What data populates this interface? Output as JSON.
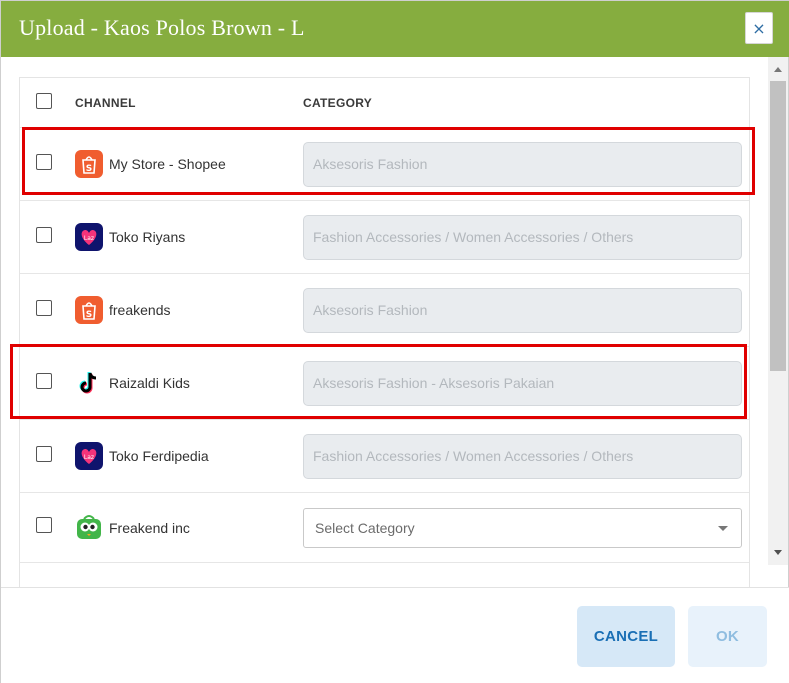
{
  "dialog": {
    "title": "Upload - Kaos Polos Brown - L",
    "close_label": "×"
  },
  "table": {
    "columns": {
      "channel": "CHANNEL",
      "category": "CATEGORY"
    },
    "rows": [
      {
        "channel": "My Store - Shopee",
        "icon": "shopee-icon",
        "category": "Aksesoris Fashion",
        "type": "readonly",
        "highlighted": true
      },
      {
        "channel": "Toko Riyans",
        "icon": "lazada-icon",
        "category": "Fashion Accessories / Women Accessories / Others",
        "type": "readonly",
        "highlighted": false
      },
      {
        "channel": "freakends",
        "icon": "shopee-icon",
        "category": "Aksesoris Fashion",
        "type": "readonly",
        "highlighted": false
      },
      {
        "channel": "Raizaldi Kids",
        "icon": "tiktok-icon",
        "category": "Aksesoris Fashion - Aksesoris Pakaian",
        "type": "readonly",
        "highlighted": true
      },
      {
        "channel": "Toko Ferdipedia",
        "icon": "lazada-icon",
        "category": "Fashion Accessories / Women Accessories / Others",
        "type": "readonly",
        "highlighted": false
      },
      {
        "channel": "Freakend inc",
        "icon": "tokopedia-icon",
        "category": "Select Category",
        "type": "select",
        "highlighted": false
      }
    ]
  },
  "footer": {
    "cancel_label": "CANCEL",
    "ok_label": "OK"
  },
  "colors": {
    "header": "#86ad3f",
    "highlight": "#e00000",
    "shopee": "#f05d2f",
    "lazada": "#0f146d",
    "tokopedia": "#42b549"
  }
}
